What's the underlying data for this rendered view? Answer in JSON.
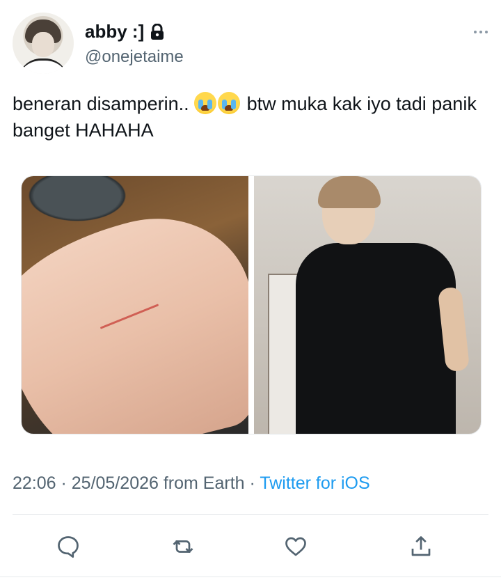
{
  "tweet": {
    "display_name": "abby :]",
    "handle": "@onejetaime",
    "text_part1": "beneran disamperin.. ",
    "text_part2": " btw muka kak iyo tadi panik banget HAHAHA",
    "emoji": "loudly-crying-face",
    "timestamp": "22:06 · 25/05/2026 from Earth · ",
    "client": "Twitter for iOS"
  },
  "icons": {
    "lock": "lock-icon",
    "more": "more-icon",
    "reply": "reply-icon",
    "retweet": "retweet-icon",
    "like": "like-icon",
    "share": "share-icon"
  },
  "colors": {
    "text": "#0f1419",
    "secondary": "#536471",
    "link": "#1d9bf0"
  }
}
